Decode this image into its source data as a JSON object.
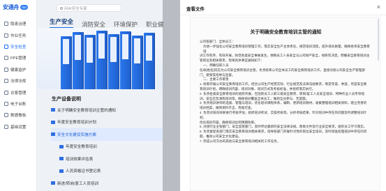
{
  "app": {
    "logo_text": "安通舟",
    "logo_badge": "doc"
  },
  "sidebar": {
    "items": [
      {
        "label": "隐患治理",
        "icon": "hazard-icon"
      },
      {
        "label": "作业任务",
        "icon": "task-icon"
      },
      {
        "label": "安全检查",
        "icon": "check-icon"
      },
      {
        "label": "PPE管理",
        "icon": "ppe-icon"
      },
      {
        "label": "健康监护",
        "icon": "health-icon"
      },
      {
        "label": "法律法规",
        "icon": "law-icon"
      },
      {
        "label": "访客管理",
        "icon": "visitor-icon"
      },
      {
        "label": "电子台账",
        "icon": "ledger-icon"
      },
      {
        "label": "数据看板",
        "icon": "dashboard-icon"
      },
      {
        "label": "基础设置",
        "icon": "settings-icon"
      }
    ],
    "active_index": 2
  },
  "search": {
    "placeholder": "问AI安全专家"
  },
  "tabs": [
    {
      "label": "生产安全",
      "active": true
    },
    {
      "label": "消防安全",
      "active": false
    },
    {
      "label": "环境保护",
      "active": false
    },
    {
      "label": "职业健",
      "active": false
    }
  ],
  "section": {
    "title": "生产设备说明"
  },
  "tree": [
    {
      "label": "关于明确安全教育培训主管的通知",
      "level": 1,
      "selected": false
    },
    {
      "label": "年度安全教育培训计划",
      "level": 1,
      "selected": false
    },
    {
      "label": "安全文化建设实施方案",
      "level": 1,
      "selected": true
    },
    {
      "label": "年度安全教育培训",
      "level": 2,
      "selected": false
    },
    {
      "label": "培训效果评估表",
      "level": 2,
      "selected": false
    },
    {
      "label": "人员资格证书登记表",
      "level": 2,
      "selected": false
    },
    {
      "label": "新进/转岗/复工人员培训",
      "level": 1,
      "selected": false
    }
  ],
  "panel": {
    "title": "查看文件",
    "close_symbol": "×"
  },
  "document": {
    "title": "关于明确安全教育培训主管的通知",
    "lines": [
      {
        "text": "公司各部门、全体员工：",
        "indent": false
      },
      {
        "text": "为进一步强化公司安全教育培训管理工作，落实安全生产主体责任，规范培训流程，提升培训质量，确保各项安全教育培",
        "indent": true
      },
      {
        "text": "训工作有序、有效开展，防范各类安全事故发生，保障员工人身安全与公司财产安全，经研究决定，明确安全教育培训主",
        "indent": false
      },
      {
        "text": "管岗位及相关职责，现将具体事宜通知如下：",
        "indent": false
      },
      {
        "text": "一、明确任职人员",
        "indent": true
      },
      {
        "text": "任命[姓名]同志为公司安全教育培训主管，负责统筹公司全体员工的安全教育培训工作，直接对接公司安全生产管理部",
        "indent": false
      },
      {
        "text": "门，接受其指导与监督。",
        "indent": false
      },
      {
        "text": "二、主要工作职责",
        "indent": true
      },
      {
        "text": "1. 统筹开展公司安全教育培训工作，结合公司生产经营实际、行业规范及法律法规要求，制定年度、季度、月度安全教",
        "indent": false
      },
      {
        "text": "育培训计划，明确培训内容、培训对象、培训方式及考核标准，并组织落实执行。",
        "indent": false
      },
      {
        "text": "2. 负责各类安全教育培训的组织开展，包括新员工入职三级安全教育、转岗/复工人员安全培训、特种作业人员专项培",
        "indent": false
      },
      {
        "text": "训、安全应急演练培训等，确保培训覆盖全体员工，做到全员参与、无遗漏。",
        "indent": false
      },
      {
        "text": "3. 负责培训讲师的选拔、管理与培训，优化培训课程体系，编制、更新培训教材，收集整理培训相关资料，建立完善的",
        "indent": false
      },
      {
        "text": "培训档案，做到资料齐全、有据可查。",
        "indent": false
      },
      {
        "text": "4. 负责对培训效果进行考核评估，组织培训考试、实操考核等，分析考核结果，针对培训中存在的问题及时调整培训计划，",
        "indent": false
      },
      {
        "text": "优化培训内容，确保培训达到预期效果。",
        "indent": false
      },
      {
        "text": "5. 对接行业主管部门、安全监管部门，及时传达最新的安全法律法规、政策文件及行业安全要求，组织员工学习落实。",
        "indent": false
      },
      {
        "text": "6. 负责督促各部门落实安全教育培训相关要求，指导各部门开展针对性的岗位安全培训，及时调查处理培训中存在的问",
        "indent": false
      },
      {
        "text": "题，推动公司安全文化建设。",
        "indent": false
      },
      {
        "text": "7. 完成公司交办的其他与安全教育培训相关的工作任务。",
        "indent": false
      }
    ]
  },
  "colors": {
    "brand": "#1b5fd8",
    "accent": "#2f7bf5",
    "selected_bg": "#dfeafe",
    "overlay": "#323741"
  }
}
